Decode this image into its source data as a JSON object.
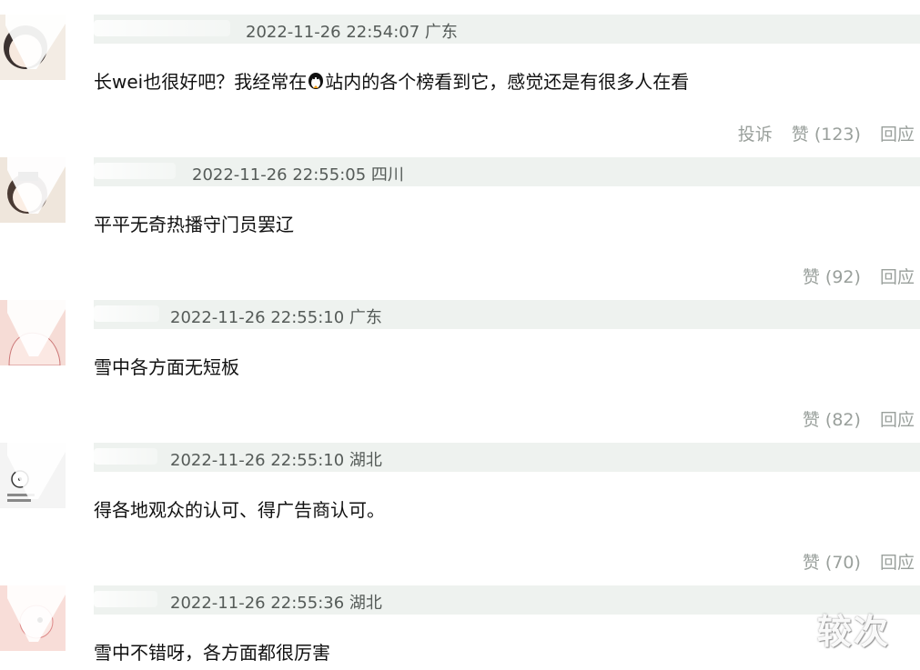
{
  "comments": [
    {
      "time": "2022-11-26 22:54:07",
      "region": "广东",
      "text_before": "长wei也很好吧？我经常在",
      "text_after": "站内的各个榜看到它，感觉还是有很多人在看",
      "inline_icon": "penguin-icon",
      "report": "投诉",
      "like": "赞 (123)",
      "reply": "回应",
      "avatar_bg": "#f3ece4"
    },
    {
      "time": "2022-11-26 22:55:05",
      "region": "四川",
      "text": "平平无奇热播守门员罢辽",
      "like": "赞 (92)",
      "reply": "回应",
      "avatar_bg": "#efe6dc"
    },
    {
      "time": "2022-11-26 22:55:10",
      "region": "广东",
      "text": "雪中各方面无短板",
      "like": "赞 (82)",
      "reply": "回应",
      "avatar_bg": "#f6dcd6"
    },
    {
      "time": "2022-11-26 22:55:10",
      "region": "湖北",
      "text": "得各地观众的认可、得广告商认可。",
      "like": "赞 (70)",
      "reply": "回应",
      "avatar_bg": "#f4f4f4"
    },
    {
      "time": "2022-11-26 22:55:36",
      "region": "湖北",
      "text": "雪中不错呀，各方面都很厉害",
      "avatar_bg": "#f8ddd8"
    }
  ],
  "watermark": "较次"
}
